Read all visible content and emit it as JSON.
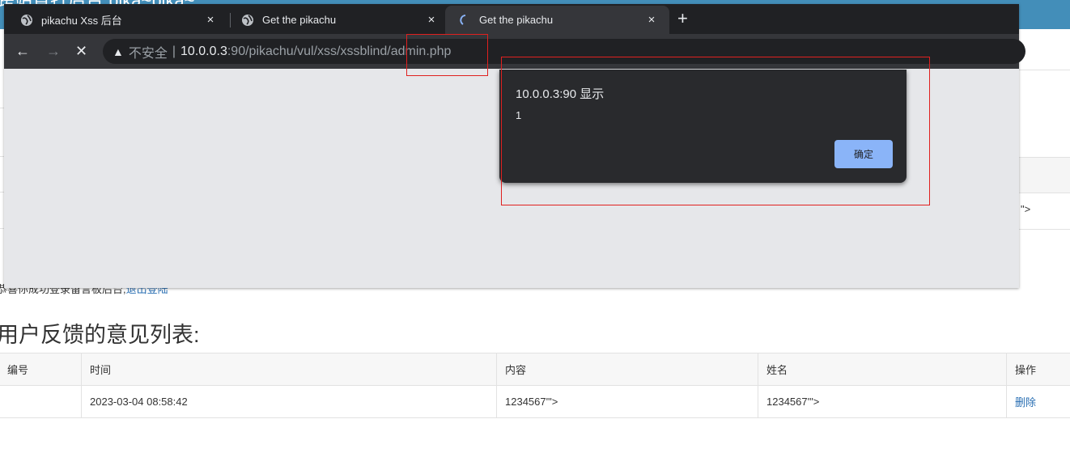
{
  "background_page": {
    "header_title": "跨站盲打后台 pika~pika~",
    "right_fragment": "\">",
    "login_notice": "恭喜你成功登录留言板后台,",
    "logout_link": "退出登陆",
    "list_title": "用户反馈的意见列表:",
    "table": {
      "headers": [
        "编号",
        "时间",
        "内容",
        "姓名",
        "操作"
      ],
      "rows": [
        {
          "id": "",
          "time": "2023-03-04 08:58:42",
          "content": "1234567'\">",
          "name": "1234567'\">",
          "action": "删除"
        }
      ]
    }
  },
  "browser": {
    "tabs": [
      {
        "title": "pikachu Xss 后台",
        "icon": "globe-icon",
        "close": "×",
        "active": false
      },
      {
        "title": "Get the pikachu",
        "icon": "globe-icon",
        "close": "×",
        "active": false
      },
      {
        "title": "Get the pikachu",
        "icon": "loading-spinner-icon",
        "close": "×",
        "active": true
      }
    ],
    "new_tab": "+",
    "nav": {
      "back": "←",
      "forward": "→",
      "stop": "✕"
    },
    "address": {
      "security_icon": "warning-triangle-icon",
      "insecure_label": "不安全",
      "separator": "|",
      "host": "10.0.0.3",
      "rest": ":90/pikachu/vul/xss/xssblind/admin.php"
    }
  },
  "alert_dialog": {
    "title": "10.0.0.3:90 显示",
    "message": "1",
    "ok_label": "确定"
  },
  "colors": {
    "annotation_red": "#e0201f",
    "page_header_blue": "#438eb9",
    "dialog_button_blue": "#8ab4f8"
  }
}
